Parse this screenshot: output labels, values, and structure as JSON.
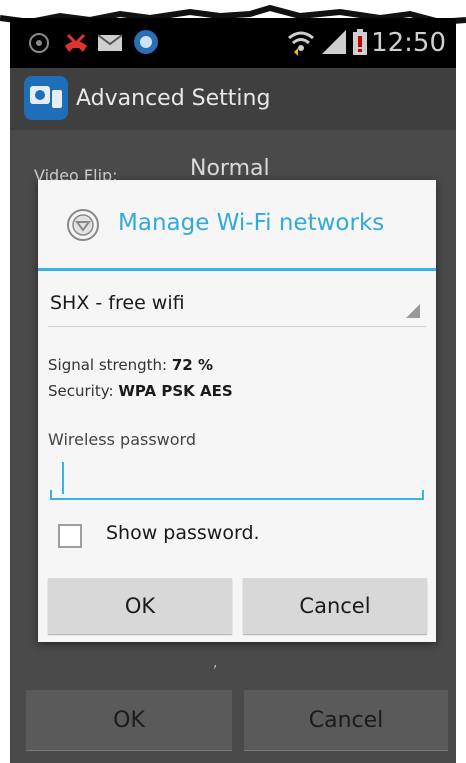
{
  "status_bar": {
    "time": "12:50",
    "icons": [
      "sd-card-icon",
      "missed-call-icon",
      "email-icon",
      "app-notification-icon",
      "wifi-icon",
      "signal-icon",
      "battery-warning-icon"
    ]
  },
  "action_bar": {
    "title": "Advanced Setting"
  },
  "background_form": {
    "video_flip_label": "Video Flip:",
    "video_flip_value": "Normal",
    "bottom_ok": "OK",
    "bottom_cancel": "Cancel"
  },
  "dialog": {
    "title": "Manage Wi-Fi networks",
    "network_selected": "SHX - free wifi",
    "signal_label": "Signal strength:",
    "signal_value": "72 %",
    "security_label": "Security:",
    "security_value": "WPA PSK AES",
    "password_label": "Wireless password",
    "password_value": "",
    "show_password_label": "Show password.",
    "show_password_checked": false,
    "ok_label": "OK",
    "cancel_label": "Cancel"
  },
  "colors": {
    "accent": "#33b5e5",
    "status_bar": "#000000",
    "dim_overlay": "#4a4a4a"
  }
}
